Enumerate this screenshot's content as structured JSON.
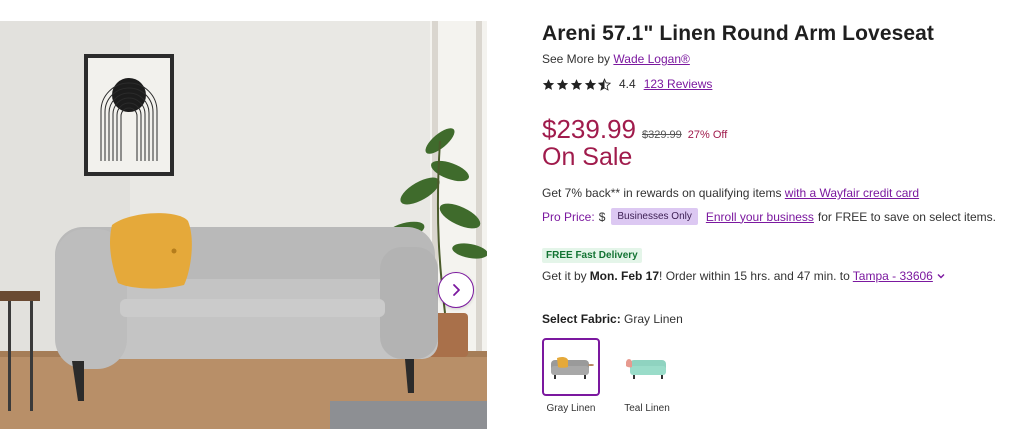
{
  "product": {
    "title": "Areni 57.1\" Linen Round Arm Loveseat",
    "see_more_prefix": "See More by",
    "brand": "Wade Logan®",
    "rating": "4.4",
    "reviews": "123 Reviews",
    "price": "$239.99",
    "was_price": "$329.99",
    "discount": "27% Off",
    "sale_label": "On Sale"
  },
  "rewards": {
    "text": "Get 7% back** in rewards on qualifying items",
    "link": "with a Wayfair credit card"
  },
  "pro_price": {
    "label": "Pro Price:",
    "dollar": "$",
    "badge": "Businesses Only",
    "link": "Enroll your business",
    "suffix": "for FREE to save on select items."
  },
  "delivery": {
    "badge": "FREE Fast Delivery",
    "prefix": "Get it by",
    "date": "Mon. Feb 17",
    "middle": "! Order within 15 hrs. and 47 min. to",
    "location": "Tampa - 33606"
  },
  "fabric": {
    "label": "Select Fabric:",
    "selected": "Gray Linen",
    "options": [
      {
        "label": "Gray Linen",
        "color": "#9a9a9a"
      },
      {
        "label": "Teal Linen",
        "color": "#8fd3c0"
      }
    ]
  },
  "icons": {
    "star": "star-icon",
    "next": "chevron-right-icon",
    "dropdown": "chevron-down-icon"
  },
  "colors": {
    "accent": "#7b189f",
    "sale": "#a01b4c",
    "delivery_green": "#137333"
  }
}
